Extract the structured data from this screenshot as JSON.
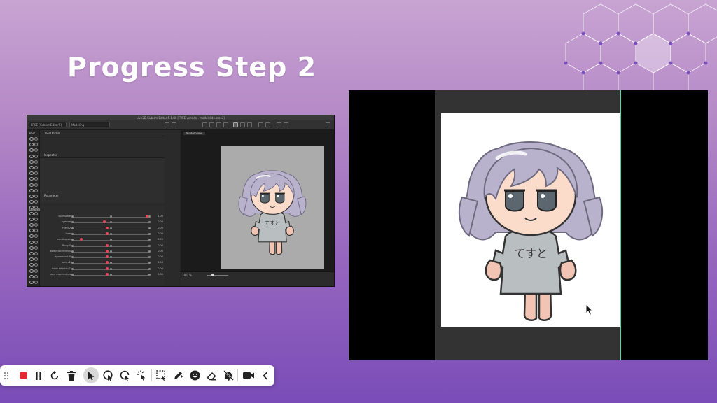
{
  "slide": {
    "title": "Progress Step 2",
    "accent_color": "#ffffff",
    "background_top": "#c8a4d2",
    "background_bottom": "#7a4cb8"
  },
  "editor": {
    "window_title": "Live2D Cubism Editor 5.1.00   [FREE version - modelslide.cmo3]",
    "model_selector": "FREE [CubismEditor5]",
    "mode_selector": "Modeling",
    "view_tab": "Model View",
    "panel_tabs": [
      "Part",
      "Tool Details",
      "Inspector",
      "Parameter"
    ],
    "deformer_tab": "Deformer",
    "parameters": [
      {
        "label": "openstare",
        "value": "1.00"
      },
      {
        "label": "eyeroro",
        "value": "0.00"
      },
      {
        "label": "eyeoy2",
        "value": "0.00"
      },
      {
        "label": "face",
        "value": "0.00"
      },
      {
        "label": "mouthopen",
        "value": "0.00"
      },
      {
        "label": "Body Y",
        "value": "0.00"
      },
      {
        "label": "bodymovements",
        "value": "0.00"
      },
      {
        "label": "eyeroboost Y",
        "value": "0.00"
      },
      {
        "label": "bodyx2",
        "value": "0.00"
      },
      {
        "label": "body rotation 1",
        "value": "0.00"
      },
      {
        "label": "arm movements",
        "value": "0.00"
      }
    ],
    "zoom": "18.0 %"
  },
  "preview": {
    "shirt_text": "てすと"
  },
  "recording_toolbar": {
    "stop_color": "#e8282e",
    "icons": [
      "drag-handle-icon",
      "stop-record-icon",
      "pause-icon",
      "restart-icon",
      "delete-icon",
      "pointer-icon",
      "click-highlight-icon",
      "spotlight-icon",
      "laser-pointer-icon",
      "select-area-icon",
      "pen-icon",
      "emoji-icon",
      "eraser-icon",
      "mute-icon",
      "camera-icon",
      "collapse-icon"
    ]
  }
}
